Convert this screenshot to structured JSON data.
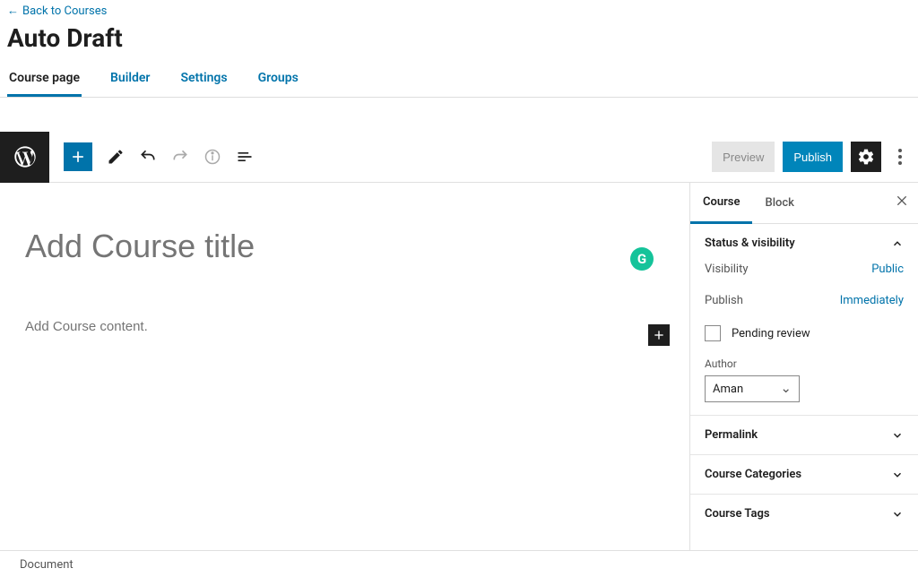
{
  "header": {
    "back_label": "Back to Courses",
    "title": "Auto Draft"
  },
  "tabs": {
    "course_page": "Course page",
    "builder": "Builder",
    "settings": "Settings",
    "groups": "Groups"
  },
  "toolbar": {
    "preview": "Preview",
    "publish": "Publish"
  },
  "editor": {
    "title_placeholder": "Add Course title",
    "content_placeholder": "Add Course content.",
    "grammarly_badge": "G"
  },
  "sidebar": {
    "tab_course": "Course",
    "tab_block": "Block",
    "status_panel": {
      "title": "Status & visibility",
      "visibility_label": "Visibility",
      "visibility_value": "Public",
      "publish_label": "Publish",
      "publish_value": "Immediately",
      "pending_review": "Pending review",
      "author_label": "Author",
      "author_value": "Aman"
    },
    "permalink": "Permalink",
    "categories": "Course Categories",
    "tags": "Course Tags"
  },
  "footer": {
    "document": "Document"
  }
}
